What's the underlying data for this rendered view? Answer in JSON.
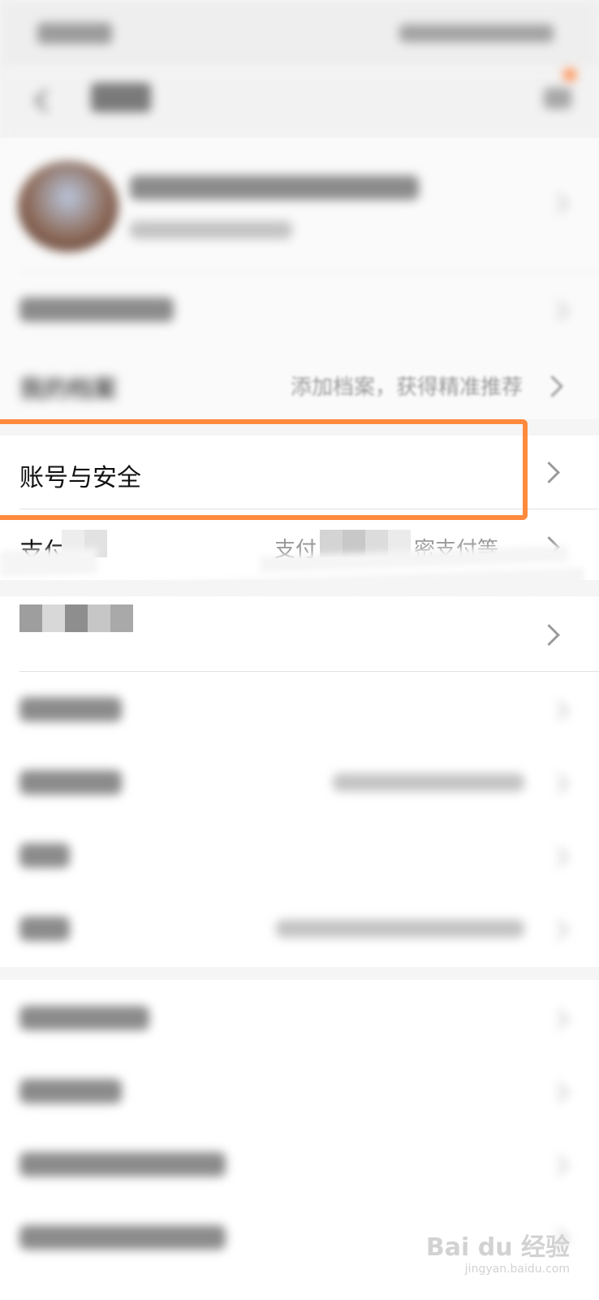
{
  "rows": {
    "account_security": {
      "label": "账号与安全"
    },
    "payment": {
      "label_partial": "支付",
      "hint_start": "支付",
      "hint_end": "密支付等"
    },
    "profile_hint": {
      "hint": "添加档案，获得精准推荐"
    },
    "profile_label_partial": "我的档案"
  },
  "watermark": {
    "brand": "Bai du 经验",
    "url": "jingyan.baidu.com"
  },
  "colors": {
    "highlight": "#ff8a3d",
    "badge": "#ff8a4a",
    "background": "#f5f5f5"
  }
}
